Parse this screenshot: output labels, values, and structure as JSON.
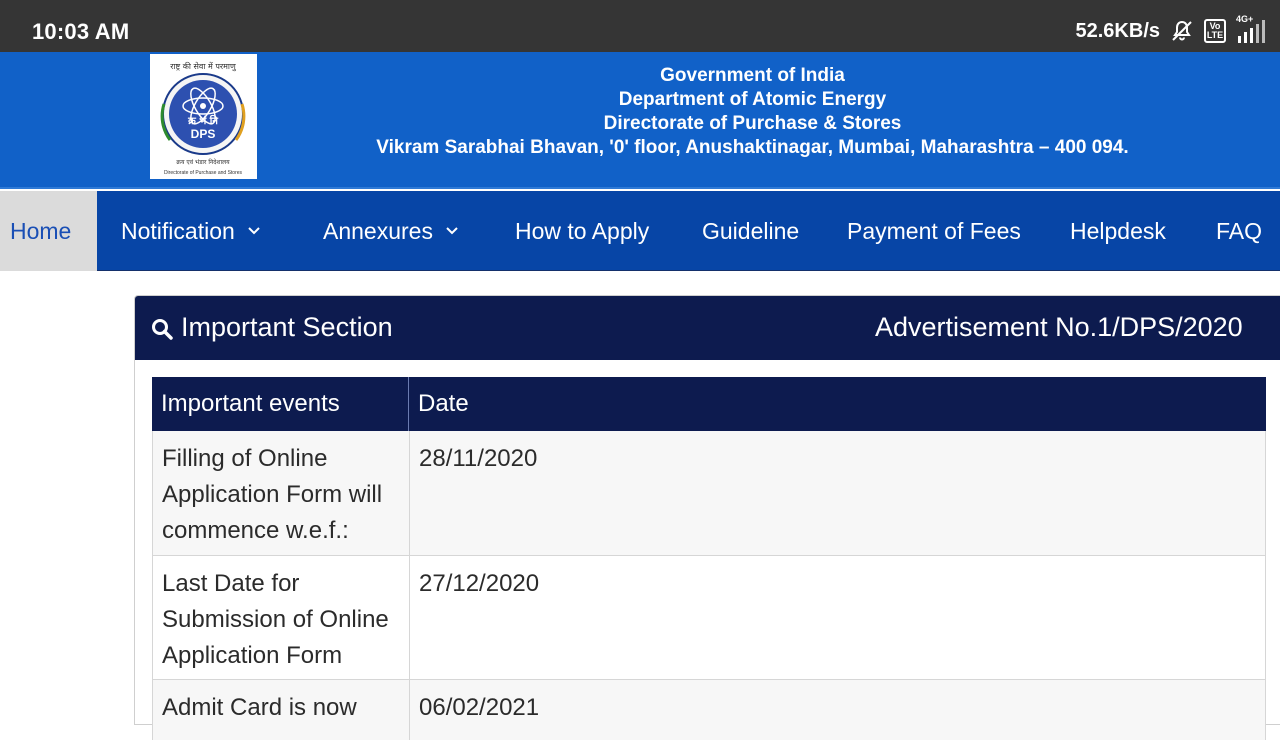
{
  "status_bar": {
    "time": "10:03 AM",
    "net_speed": "52.6KB/s",
    "volte_label": "Vo\nLTE",
    "network_label": "4G+"
  },
  "header": {
    "logo": {
      "top_text": "राष्ट्र की सेवा में परमाणु",
      "arc_text": "ATOMS IN THE SERVICE OF THE NATION",
      "hindi_abbr": "क्र भं नि",
      "abbr": "DPS",
      "hindi_name": "क्रय एवं भंडार निदेशालय",
      "caption": "Directorate of Purchase and Stores"
    },
    "lines": [
      "Government of India",
      "Department of Atomic Energy",
      "Directorate of Purchase & Stores",
      "Vikram Sarabhai Bhavan, '0' floor, Anushaktinagar, Mumbai, Maharashtra – 400 094."
    ],
    "bg_color": "#1161c8"
  },
  "nav": {
    "items": [
      {
        "label": "Home",
        "active": true
      },
      {
        "label": "Notification",
        "dropdown": true
      },
      {
        "label": "Annexures",
        "dropdown": true
      },
      {
        "label": "How to Apply"
      },
      {
        "label": "Guideline"
      },
      {
        "label": "Payment of Fees"
      },
      {
        "label": "Helpdesk"
      },
      {
        "label": "FAQ"
      }
    ],
    "bg_color": "#0745a6"
  },
  "section": {
    "icon": "search-icon",
    "title": "Important Section",
    "advertisement": "Advertisement No.1/DPS/2020",
    "header_color": "#0d1b4f",
    "table": {
      "headers": [
        "Important events",
        "Date"
      ],
      "rows": [
        {
          "event": "Filling of Online Application Form will commence w.e.f.:",
          "date": "28/11/2020"
        },
        {
          "event": "Last Date for Submission of Online Application Form",
          "date": "27/12/2020"
        },
        {
          "event": "Admit Card is now",
          "date": "06/02/2021"
        }
      ]
    }
  }
}
